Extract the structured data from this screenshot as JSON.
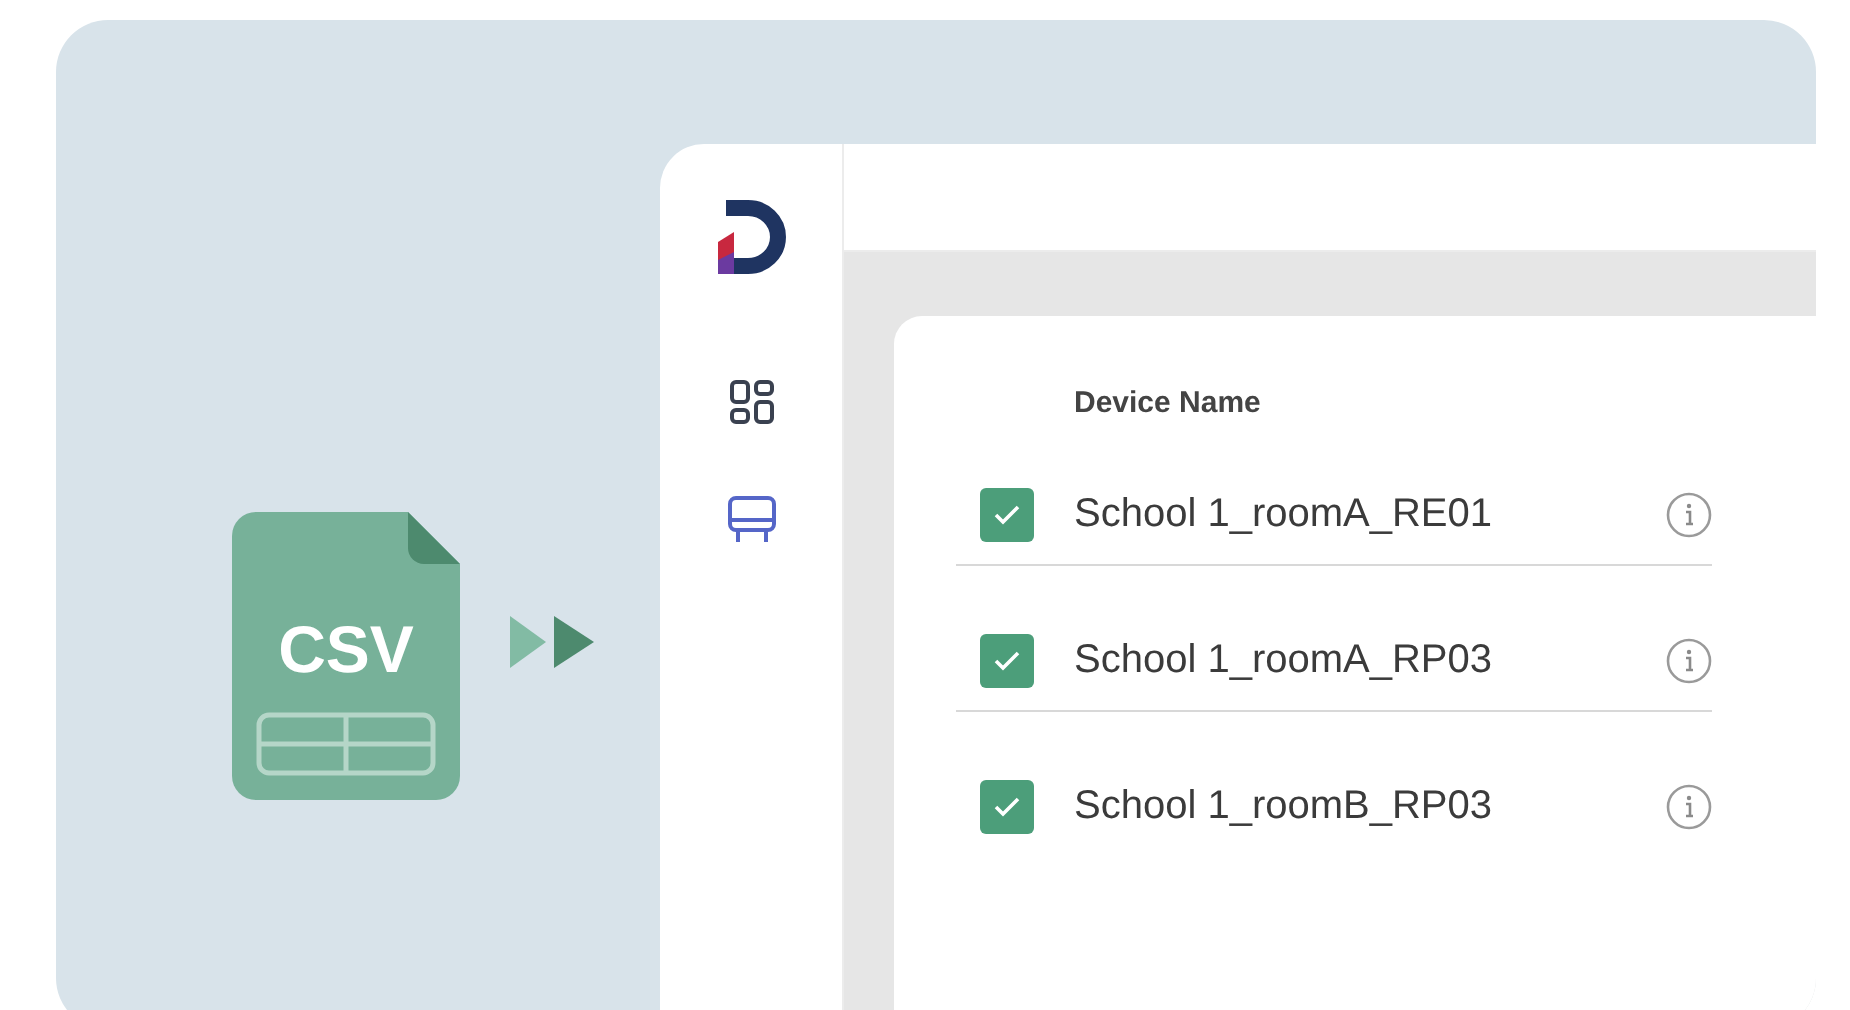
{
  "file_icon": {
    "label": "CSV"
  },
  "nav": [
    {
      "kind": "grid",
      "selected": false
    },
    {
      "kind": "device",
      "selected": true
    }
  ],
  "table": {
    "columns": [
      "Device Name"
    ],
    "rows": [
      {
        "name": "School 1_roomA_RE01",
        "checked": true
      },
      {
        "name": "School 1_roomA_RP03",
        "checked": true
      },
      {
        "name": "School 1_roomB_RP03",
        "checked": true
      }
    ]
  }
}
